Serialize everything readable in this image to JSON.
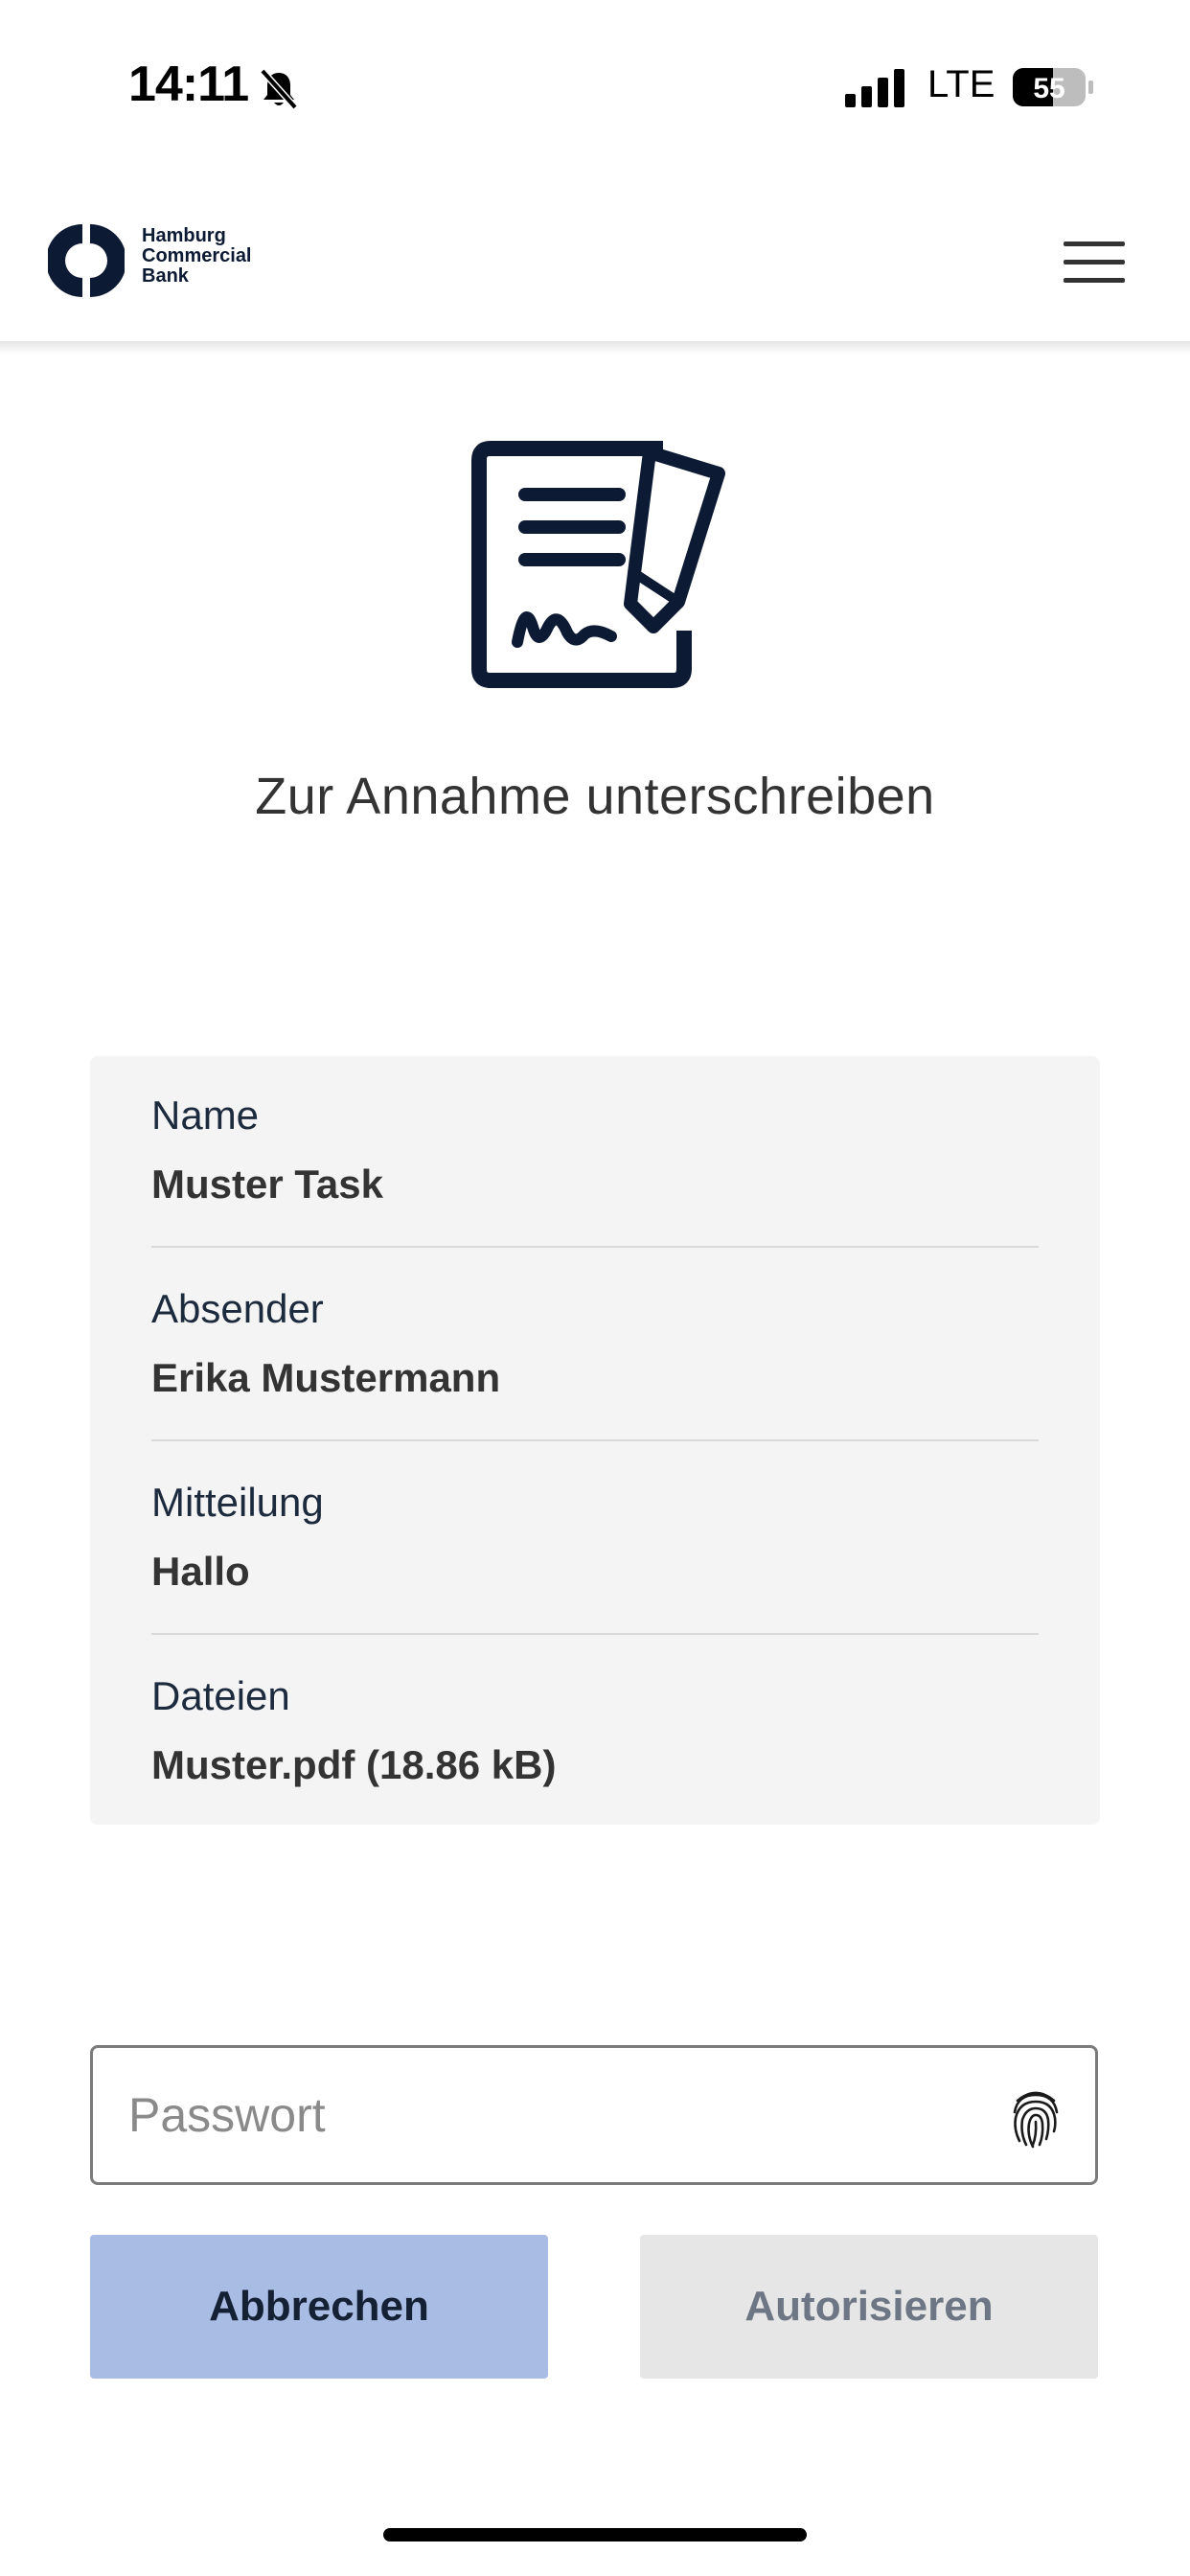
{
  "status_bar": {
    "time": "14:11",
    "network": "LTE",
    "battery": "55"
  },
  "header": {
    "logo_lines": [
      "Hamburg",
      "Commercial",
      "Bank"
    ],
    "menu_icon": "hamburger-menu-icon"
  },
  "hero": {
    "icon": "document-signature-icon",
    "title": "Zur Annahme unterschreiben"
  },
  "details": [
    {
      "label": "Name",
      "value": "Muster Task"
    },
    {
      "label": "Absender",
      "value": "Erika Mustermann"
    },
    {
      "label": "Mitteilung",
      "value": "Hallo"
    },
    {
      "label": "Dateien",
      "value": "Muster.pdf (18.86 kB)"
    }
  ],
  "password": {
    "placeholder": "Passwort",
    "icon": "fingerprint-icon"
  },
  "buttons": {
    "cancel": "Abbrechen",
    "authorize": "Autorisieren"
  },
  "colors": {
    "brand_dark": "#0d1a33",
    "cancel_bg": "#a9bce4",
    "authorize_bg": "#e6e6e6",
    "card_bg": "#f4f4f4"
  }
}
